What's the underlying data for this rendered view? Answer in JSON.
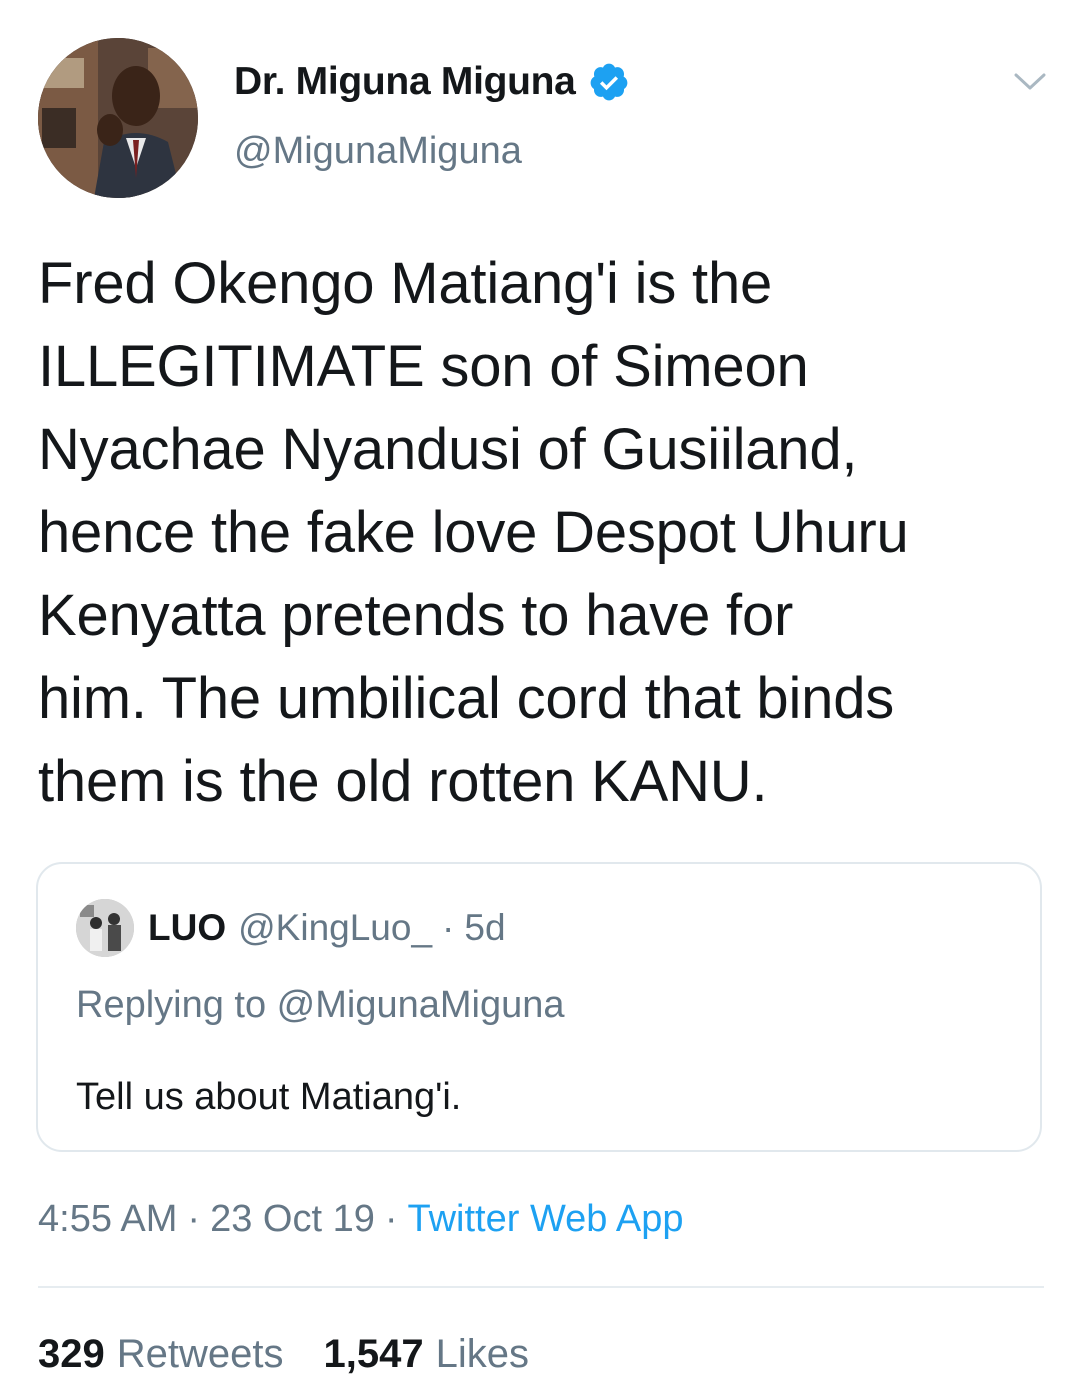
{
  "author": {
    "name": "Dr. Miguna Miguna",
    "handle": "@MigunaMiguna",
    "verified": true,
    "avatar_icon": "profile-photo"
  },
  "menu_icon": "chevron-down-icon",
  "tweet": {
    "text": "Fred Okengo Matiang'i is the\nILLEGITIMATE son of Simeon\nNyachae Nyandusi of Gusiiland,\nhence the fake love Despot Uhuru\nKenyatta pretends to have for\nhim. The umbilical cord that binds\nthem is the old rotten KANU."
  },
  "quoted_tweet": {
    "name": "LUO",
    "handle": "@KingLuo_",
    "dot": "·",
    "time": "5d",
    "replying_to": "Replying to @MigunaMiguna",
    "text": "Tell us about Matiang'i."
  },
  "meta": {
    "time": "4:55 AM",
    "sep1": "·",
    "date": "23 Oct 19",
    "sep2": "·",
    "source": "Twitter Web App"
  },
  "stats": {
    "retweets_count": "329",
    "retweets_label": "Retweets",
    "likes_count": "1,547",
    "likes_label": "Likes"
  },
  "colors": {
    "text_primary": "#14171a",
    "text_secondary": "#657786",
    "link": "#1da1f2",
    "verified": "#1da1f2",
    "border": "#e1e8ed"
  }
}
